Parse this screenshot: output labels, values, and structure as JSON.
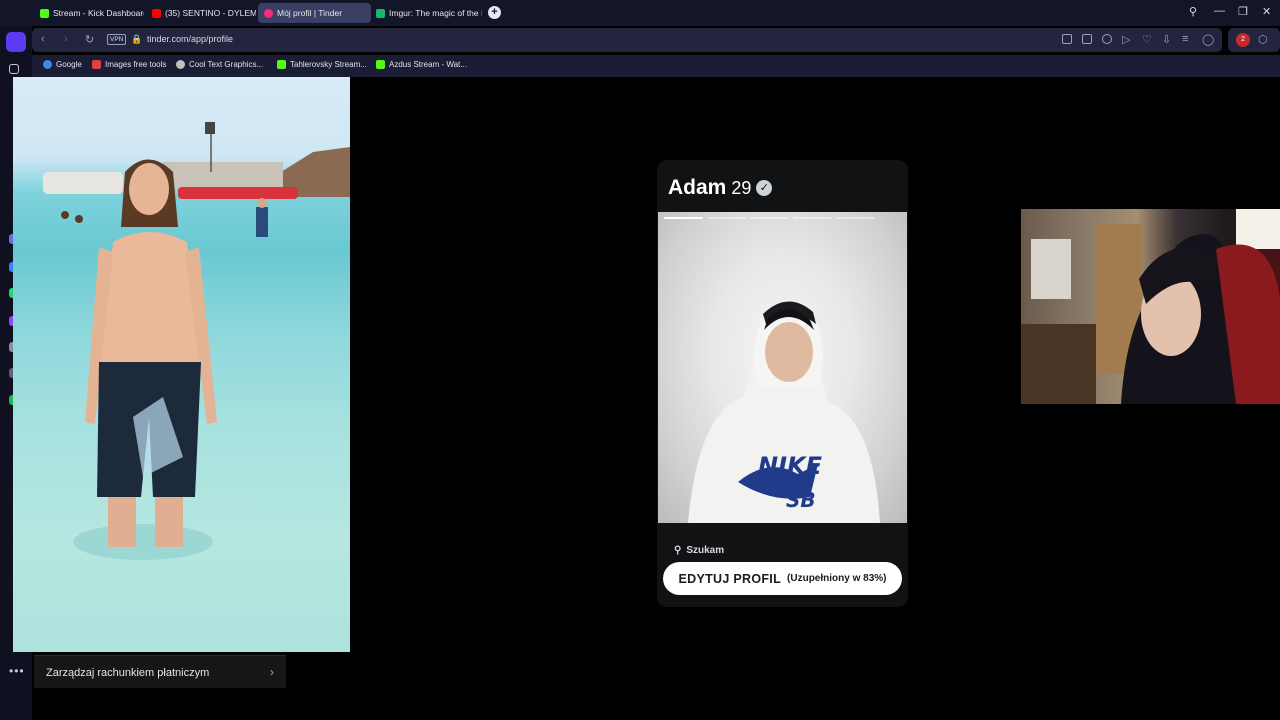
{
  "tabs": [
    {
      "title": "Stream - Kick Dashboard",
      "favicon": "kick-icon",
      "color": "#53fc18"
    },
    {
      "title": "(35) SENTINO - DYLEM",
      "favicon": "youtube-icon",
      "color": "#ff0000"
    },
    {
      "title": "Mój profil | Tinder",
      "favicon": "tinder-icon",
      "color": "#fd297b",
      "active": true
    },
    {
      "title": "Imgur: The magic of the In",
      "favicon": "imgur-icon",
      "color": "#1bb76e"
    }
  ],
  "address": {
    "url": "tinder.com/app/profile",
    "vpn_label": "VPN"
  },
  "bookmarks": [
    {
      "label": "Google",
      "icon": "google-icon",
      "color": "#4285f4"
    },
    {
      "label": "Images free tools",
      "icon": "images-tool-icon",
      "color": "#e04040"
    },
    {
      "label": "Cool Text Graphics...",
      "icon": "cooltext-icon",
      "color": "#c0c0c0"
    },
    {
      "label": "Tahlerovsky Stream...",
      "icon": "kick-icon",
      "color": "#53fc18"
    },
    {
      "label": "Azdus Stream - Wat...",
      "icon": "kick-icon",
      "color": "#53fc18"
    }
  ],
  "profile": {
    "name": "Adam",
    "age": "29",
    "verified_icon": "verified-badge-icon",
    "seeking_label": "Szukam",
    "edit_button": "EDYTUJ PROFIL",
    "completion": "(Uzupełniony w 83%)",
    "photo_count": 5,
    "current_photo": 1
  },
  "payment": {
    "label": "Zarządzaj rachunkiem płatniczym"
  },
  "extension_badge": "2",
  "colors": {
    "accent": "#5b3cf0",
    "tinder": "#fd297b",
    "chrome_bg": "#131528"
  }
}
